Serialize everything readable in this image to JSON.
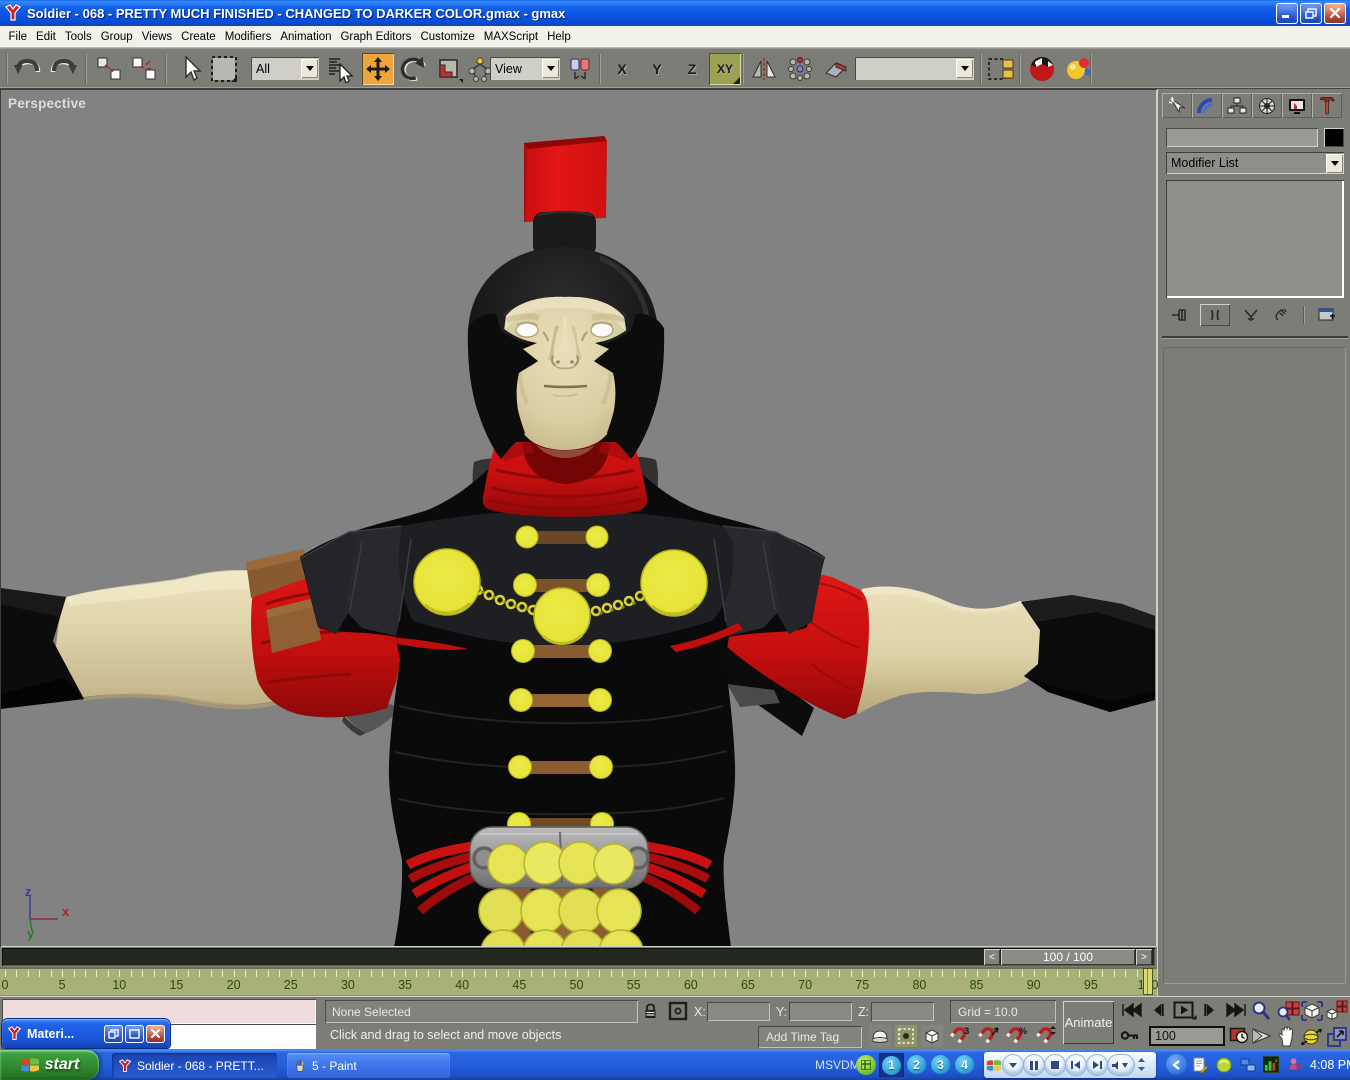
{
  "window": {
    "title": "Soldier - 068 - PRETTY MUCH FINISHED - CHANGED TO DARKER COLOR.gmax - gmax",
    "app_name": "gmax"
  },
  "menubar": {
    "items": [
      "File",
      "Edit",
      "Tools",
      "Group",
      "Views",
      "Create",
      "Modifiers",
      "Animation",
      "Graph Editors",
      "Customize",
      "MAXScript",
      "Help"
    ]
  },
  "toolbar": {
    "selection_filter": "All",
    "coord_system": "View",
    "named_selection": "",
    "axis_x": "X",
    "axis_y": "Y",
    "axis_z": "Z",
    "axis_xy": "XY",
    "active_tool": "select-and-move",
    "active_axis_constraint": "XY",
    "icons": [
      "undo-icon",
      "redo-icon",
      "select-and-link-icon",
      "unlink-selection-icon",
      "select-object-icon",
      "selection-region-icon",
      "select-by-name-icon",
      "select-and-move-icon",
      "select-and-rotate-icon",
      "select-and-scale-icon",
      "select-and-manipulate-icon",
      "use-pivot-center-icon",
      "mirror-icon",
      "array-icon",
      "align-icon",
      "track-view-icon",
      "material-editor-icon",
      "render-icon"
    ]
  },
  "viewport": {
    "label": "Perspective",
    "axis_x": "x",
    "axis_y": "y",
    "axis_z": "z"
  },
  "command_panel": {
    "object_name": "",
    "modifier_list_label": "Modifier List",
    "tabs": [
      "create",
      "modify",
      "hierarchy",
      "motion",
      "display",
      "utilities"
    ],
    "stack_buttons": [
      "pin-stack",
      "show-end-result",
      "make-unique",
      "remove-modifier",
      "configure-modifier-sets"
    ]
  },
  "time_slider": {
    "value": "100 / 100",
    "prev": "<",
    "next": ">"
  },
  "trackbar": {
    "start": 0,
    "end": 100,
    "label_step": 5,
    "current": 100
  },
  "status_bar": {
    "selection": "None Selected",
    "prompt": "Click and drag to select and move objects",
    "add_time_tag": "Add Time Tag",
    "grid": "Grid = 10.0",
    "x_label": "X:",
    "y_label": "Y:",
    "z_label": "Z:",
    "x_value": "",
    "y_value": "",
    "z_value": "",
    "animate": "Animate",
    "frame": "100",
    "playback_icons": [
      "go-to-start-icon",
      "previous-frame-icon",
      "play-icon",
      "next-frame-icon",
      "go-to-end-icon",
      "set-key-icon",
      "time-configuration-icon"
    ],
    "snap_icons": [
      "degradation-override-icon",
      "selection-brackets-icon",
      "crossing-window-icon",
      "snap-3d-icon",
      "angle-snap-icon",
      "percent-snap-icon",
      "spinner-snap-icon"
    ],
    "nav_icons": [
      "zoom-icon",
      "zoom-all-icon",
      "zoom-extents-icon",
      "zoom-extents-all-icon",
      "field-of-view-icon",
      "pan-icon",
      "arc-rotate-icon",
      "min-max-toggle-icon"
    ]
  },
  "taskbar": {
    "start": "start",
    "tasks": [
      {
        "label": "Soldier - 068 - PRETT...",
        "active": true
      },
      {
        "label": "5 - Paint",
        "active": false
      }
    ],
    "msvdm_label": "MSVDM",
    "desktops": [
      "1",
      "2",
      "3",
      "4"
    ],
    "active_desktop": "1",
    "clock": "4:08 PM",
    "wmp_icons": [
      "wmp-menu-icon",
      "wmp-pause-icon",
      "wmp-stop-icon",
      "wmp-previous-icon",
      "wmp-next-icon",
      "wmp-volume-icon"
    ],
    "tray_icons": [
      "tray-collapse-chevron-icon",
      "tray-document-icon",
      "tray-orb-icon",
      "tray-network-icon",
      "tray-cpu-meter-icon",
      "tray-messenger-icon"
    ]
  },
  "material_window": {
    "title": "Materi..."
  },
  "colors": {
    "ui_gray": "#7d7d78",
    "viewport_gray": "#828282",
    "titlebar_blue": "#0b54e2",
    "taskbar_blue": "#2460dc",
    "trackbar_olive": "#a8b178",
    "crest_red": "#d61212",
    "armor_black": "#0d0d0d",
    "disc_yellow": "#ece93c",
    "skin": "#e3d9b2"
  }
}
